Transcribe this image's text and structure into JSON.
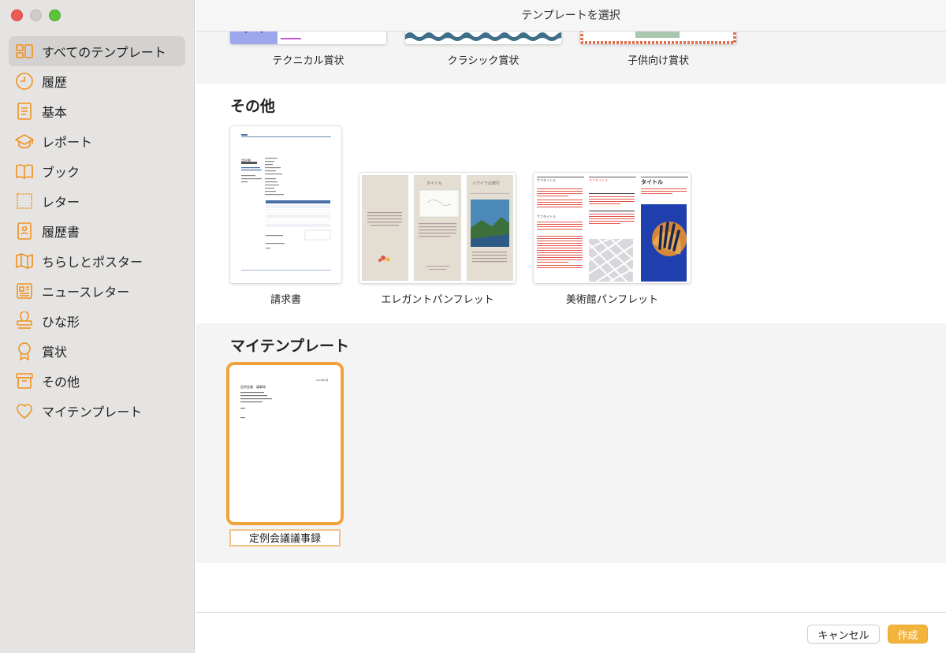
{
  "window": {
    "title": "テンプレートを選択"
  },
  "sidebar": {
    "items": [
      {
        "label": "すべてのテンプレート",
        "icon": "grid-layout-icon"
      },
      {
        "label": "履歴",
        "icon": "clock-icon"
      },
      {
        "label": "基本",
        "icon": "document-icon"
      },
      {
        "label": "レポート",
        "icon": "graduation-cap-icon"
      },
      {
        "label": "ブック",
        "icon": "book-icon"
      },
      {
        "label": "レター",
        "icon": "stamp-icon"
      },
      {
        "label": "履歴書",
        "icon": "resume-icon"
      },
      {
        "label": "ちらしとポスター",
        "icon": "map-fold-icon"
      },
      {
        "label": "ニュースレター",
        "icon": "newspaper-icon"
      },
      {
        "label": "ひな形",
        "icon": "rubber-stamp-icon"
      },
      {
        "label": "賞状",
        "icon": "ribbon-award-icon"
      },
      {
        "label": "その他",
        "icon": "archive-box-icon"
      },
      {
        "label": "マイテンプレート",
        "icon": "heart-icon"
      }
    ],
    "accent": "#f0921e"
  },
  "sections": {
    "awards": {
      "items": [
        {
          "label": "テクニカル賞状"
        },
        {
          "label": "クラシック賞状"
        },
        {
          "label": "子供向け賞状"
        }
      ]
    },
    "other": {
      "title": "その他",
      "items": [
        {
          "label": "請求書"
        },
        {
          "label": "エレガントパンフレット"
        },
        {
          "label": "美術館パンフレット"
        }
      ]
    },
    "mine": {
      "title": "マイテンプレート",
      "items": [
        {
          "label": "定例会議議事録"
        }
      ]
    }
  },
  "thumbs": {
    "invoice": {
      "heading": "請求書"
    },
    "elegant": {
      "panel2_title": "タイトル",
      "panel3_title": "ハワイでの旅行"
    },
    "museum": {
      "sub1": "サブタイトル",
      "sub2": "サブタイトル",
      "sub3": "サブタイトル",
      "title": "タイトル"
    },
    "minutes": {
      "date": "2024年4月",
      "title": "定例会議　議事録"
    }
  },
  "footer": {
    "cancel_label": "キャンセル",
    "create_label": "作成"
  },
  "colors": {
    "accent": "#f3b43c",
    "selection": "#f0a23c"
  }
}
